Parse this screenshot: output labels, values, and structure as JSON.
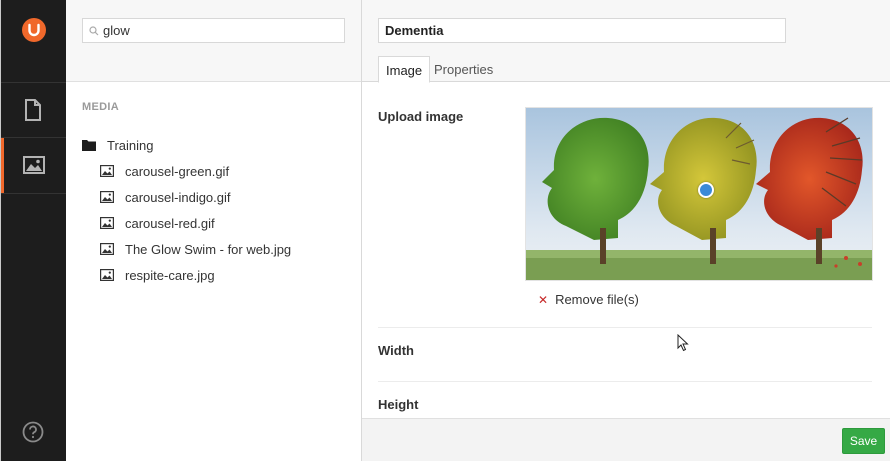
{
  "sidebar": {
    "logo": "umbraco-logo-icon",
    "sections": [
      {
        "name": "content",
        "icon": "document-icon",
        "active": false
      },
      {
        "name": "media",
        "icon": "picture-icon",
        "active": true
      }
    ],
    "help_icon": "help-icon",
    "accent_color": "#f0682b"
  },
  "tree": {
    "search": {
      "value": "glow",
      "icon": "search-icon"
    },
    "section_title": "MEDIA",
    "folder": {
      "label": "Training",
      "icon": "folder-icon"
    },
    "items": [
      {
        "label": "carousel-green.gif",
        "icon": "image-icon"
      },
      {
        "label": "carousel-indigo.gif",
        "icon": "image-icon"
      },
      {
        "label": "carousel-red.gif",
        "icon": "image-icon"
      },
      {
        "label": "The Glow Swim - for web.jpg",
        "icon": "image-icon"
      },
      {
        "label": "respite-care.jpg",
        "icon": "image-icon"
      }
    ]
  },
  "editor": {
    "name": "Dementia",
    "tabs": [
      {
        "label": "Image",
        "active": true
      },
      {
        "label": "Properties",
        "active": false
      }
    ],
    "properties": {
      "upload_label": "Upload image",
      "remove_label": "Remove file(s)",
      "width_label": "Width",
      "height_label": "Height"
    },
    "save_label": "Save",
    "save_color": "#35a945"
  }
}
